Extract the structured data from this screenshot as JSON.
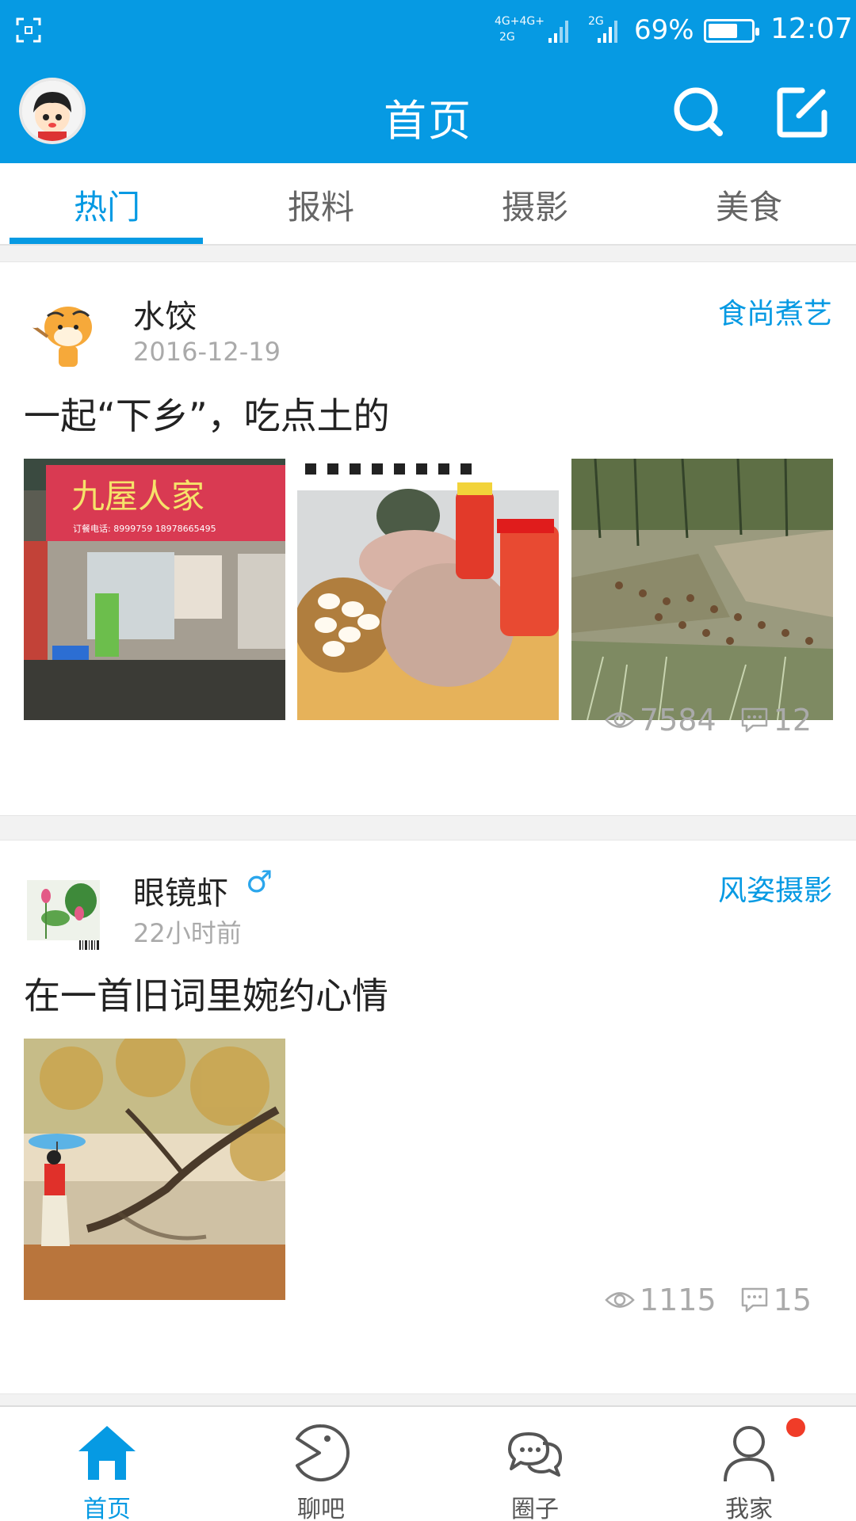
{
  "status_bar": {
    "network_1": "4G+4G+",
    "network_2": "2G",
    "network_3": "2G",
    "battery_percent": "69%",
    "battery_level": 0.69,
    "time": "12:07"
  },
  "header": {
    "title": "首页",
    "search_icon": "search-icon",
    "compose_icon": "compose-icon"
  },
  "tabs": [
    {
      "label": "热门",
      "active": true
    },
    {
      "label": "报料",
      "active": false
    },
    {
      "label": "摄影",
      "active": false
    },
    {
      "label": "美食",
      "active": false
    }
  ],
  "posts": [
    {
      "author": "水饺",
      "time": "2016-12-19",
      "circle": "食尚煮艺",
      "title": "一起“下乡”，吃点土的",
      "views": "7584",
      "comments": "12",
      "image_signs": {
        "sign_main": "九屋人家",
        "sign_phone": "订餐电话: 8999759  18978665495"
      }
    },
    {
      "author": "眼镜虾",
      "gender": "♂",
      "time": "22小时前",
      "circle": "风姿摄影",
      "title": "在一首旧词里婉约心情",
      "views": "1115",
      "comments": "15"
    }
  ],
  "bottom_nav": [
    {
      "label": "首页",
      "icon": "home-icon",
      "active": true
    },
    {
      "label": "聊吧",
      "icon": "chat-face-icon",
      "active": false
    },
    {
      "label": "圈子",
      "icon": "circle-bubbles-icon",
      "active": false
    },
    {
      "label": "我家",
      "icon": "person-icon",
      "active": false
    }
  ],
  "colors": {
    "accent": "#069ae3",
    "badge": "#f03c28"
  }
}
